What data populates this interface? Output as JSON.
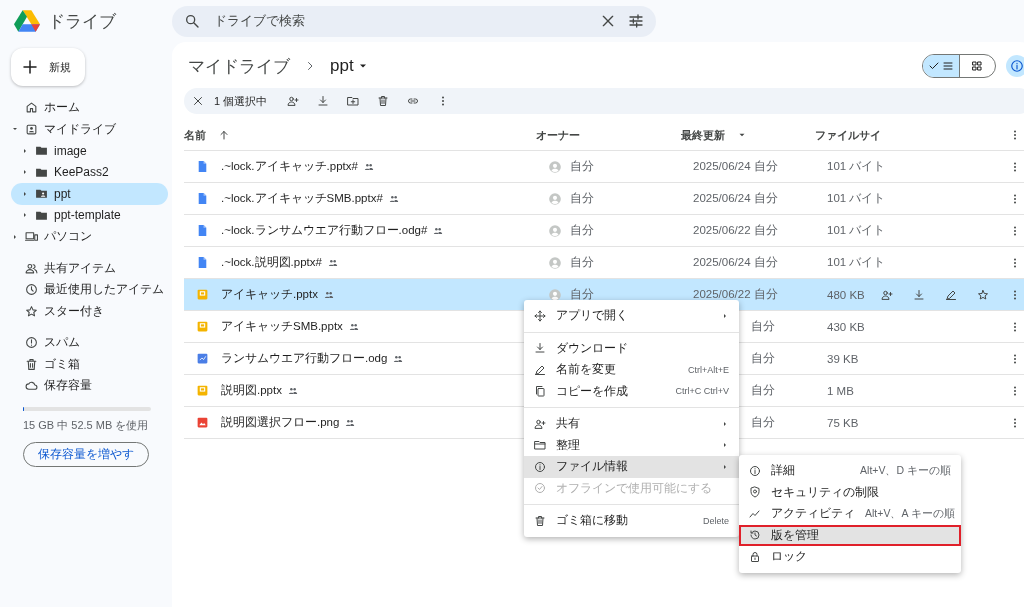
{
  "app": {
    "title": "ドライブ"
  },
  "search": {
    "placeholder": "ドライブで検索"
  },
  "sidebar": {
    "new_button": "新規",
    "sections": [
      [
        {
          "label": "ホーム",
          "selected": false
        },
        {
          "label": "マイドライブ",
          "selected": false,
          "expanded": true,
          "children": [
            {
              "label": "image",
              "selected": false,
              "expanded": false
            },
            {
              "label": "KeePass2",
              "selected": false,
              "expanded": false
            },
            {
              "label": "ppt",
              "selected": true,
              "expanded": false
            },
            {
              "label": "ppt-template",
              "selected": false,
              "expanded": false
            }
          ]
        },
        {
          "label": "パソコン",
          "selected": false,
          "expanded": false
        }
      ],
      [
        {
          "label": "共有アイテム",
          "selected": false
        },
        {
          "label": "最近使用したアイテム",
          "selected": false
        },
        {
          "label": "スター付き",
          "selected": false
        }
      ],
      [
        {
          "label": "スパム",
          "selected": false
        },
        {
          "label": "ゴミ箱",
          "selected": false
        },
        {
          "label": "保存容量",
          "selected": false
        }
      ]
    ],
    "storage": {
      "level": 0.01,
      "text": "15 GB 中 52.5 MB を使用",
      "button": "保存容量を増やす"
    }
  },
  "breadcrumb": [
    "マイドライブ",
    "ppt"
  ],
  "view_toggle": [
    {
      "selected": true
    },
    {
      "selected": false
    }
  ],
  "selection_bar": {
    "count": "1 個選択中"
  },
  "table": {
    "columns": [
      {
        "label": "名前",
        "sort_arrow": true
      },
      {
        "label": "オーナー"
      },
      {
        "label": "最終更新",
        "dropdown": true
      },
      {
        "label": "ファイルサイ"
      }
    ],
    "rows": [
      {
        "kind": "doc",
        "name": ".~lock.アイキャッチ.pptx#",
        "owner": "自分",
        "modified": "2025/06/24 自分",
        "size": "101 バイト",
        "selected": false
      },
      {
        "kind": "doc",
        "name": ".~lock.アイキャッチSMB.pptx#",
        "owner": "自分",
        "modified": "2025/06/24 自分",
        "size": "101 バイト",
        "selected": false
      },
      {
        "kind": "doc",
        "name": ".~lock.ランサムウエア行動フロー.odg#",
        "owner": "自分",
        "modified": "2025/06/22 自分",
        "size": "101 バイト",
        "selected": false
      },
      {
        "kind": "doc",
        "name": ".~lock.説明図.pptx#",
        "owner": "自分",
        "modified": "2025/06/24 自分",
        "size": "101 バイト",
        "selected": false
      },
      {
        "kind": "slides",
        "name": "アイキャッチ.pptx",
        "owner": "自分",
        "modified": "2025/06/22 自分",
        "size": "480 KB",
        "selected": true
      },
      {
        "kind": "slides",
        "name": "アイキャッチSMB.pptx",
        "modified": "自分",
        "size": "430 KB",
        "selected": false
      },
      {
        "kind": "drawing",
        "name": "ランサムウエア行動フロー.odg",
        "modified": "自分",
        "size": "39 KB",
        "selected": false
      },
      {
        "kind": "slides",
        "name": "説明図.pptx",
        "modified": "自分",
        "size": "1 MB",
        "selected": false
      },
      {
        "kind": "image",
        "name": "説明図選択フロー.png",
        "modified": "自分",
        "size": "75 KB",
        "selected": false
      }
    ]
  },
  "context_menu": {
    "groups": [
      [
        {
          "label": "アプリで開く",
          "submenu": true,
          "highlighted": false,
          "disabled": false
        }
      ],
      [
        {
          "label": "ダウンロード",
          "submenu": false,
          "highlighted": false,
          "disabled": false
        },
        {
          "label": "名前を変更",
          "shortcut": "Ctrl+Alt+E",
          "submenu": false,
          "highlighted": false,
          "disabled": false
        },
        {
          "label": "コピーを作成",
          "shortcut": "Ctrl+C Ctrl+V",
          "submenu": false,
          "highlighted": false,
          "disabled": false
        }
      ],
      [
        {
          "label": "共有",
          "submenu": true,
          "highlighted": false,
          "disabled": false
        },
        {
          "label": "整理",
          "submenu": true,
          "highlighted": false,
          "disabled": false
        },
        {
          "label": "ファイル情報",
          "submenu": true,
          "highlighted": true,
          "disabled": false
        },
        {
          "label": "オフラインで使用可能にする",
          "submenu": false,
          "highlighted": false,
          "disabled": true
        }
      ],
      [
        {
          "label": "ゴミ箱に移動",
          "shortcut": "Delete",
          "submenu": false,
          "highlighted": false,
          "disabled": false
        }
      ]
    ]
  },
  "submenu": {
    "items": [
      {
        "label": "詳細",
        "shortcut": "Alt+V、D キーの順",
        "highlighted": false,
        "outlined": false
      },
      {
        "label": "セキュリティの制限",
        "highlighted": false,
        "outlined": false
      },
      {
        "label": "アクティビティ",
        "shortcut": "Alt+V、A キーの順",
        "highlighted": false,
        "outlined": false
      },
      {
        "label": "版を管理",
        "highlighted": true,
        "outlined": true
      },
      {
        "label": "ロック",
        "highlighted": false,
        "outlined": false
      }
    ]
  }
}
